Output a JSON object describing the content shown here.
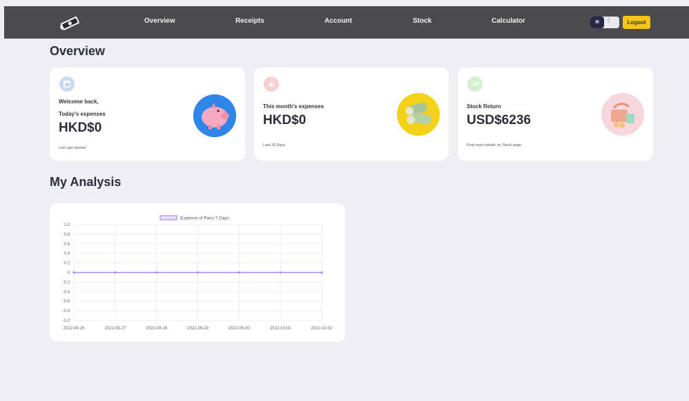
{
  "nav": {
    "items": [
      "Overview",
      "Receipts",
      "Account",
      "Stock",
      "Calculator"
    ],
    "logout_label": "Logout",
    "theme_toggle_icon": "sun-icon",
    "accent": "#f8c516"
  },
  "overview": {
    "title": "Overview",
    "cards": [
      {
        "line1": "Welcome back,",
        "line2": "Today's expenses",
        "value": "HKD$0",
        "note": "Let's get started.",
        "icon": "chart-icon",
        "badge_color": "#c9d9f5"
      },
      {
        "line1": "This month's expenses",
        "value": "HKD$0",
        "note": "Last 30 Days",
        "icon": "bar-chart-icon",
        "badge_color": "#f9d0d0"
      },
      {
        "line1": "Stock Return",
        "value": "USD$6236",
        "note": "Find more details on Stock page.",
        "icon": "trend-icon",
        "badge_color": "#d6efd0"
      }
    ]
  },
  "analysis": {
    "title": "My Analysis"
  },
  "chart_data": {
    "type": "line",
    "x": [
      "2022-09-26",
      "2022-09-27",
      "2022-09-28",
      "2022-09-29",
      "2022-09-30",
      "2022-10-01",
      "2022-10-02"
    ],
    "series": [
      {
        "name": "Expense of Pass 7 Days",
        "values": [
          0,
          0,
          0,
          0,
          0,
          0,
          0
        ],
        "color": "#a98be6"
      }
    ],
    "yticks": [
      "1.0",
      "0.8",
      "0.6",
      "0.4",
      "0.2",
      "0",
      "-0.2",
      "-0.4",
      "-0.6",
      "-0.8",
      "-1.0"
    ],
    "ylim": [
      -1.0,
      1.0
    ],
    "grid": true,
    "legend": "top-center"
  }
}
